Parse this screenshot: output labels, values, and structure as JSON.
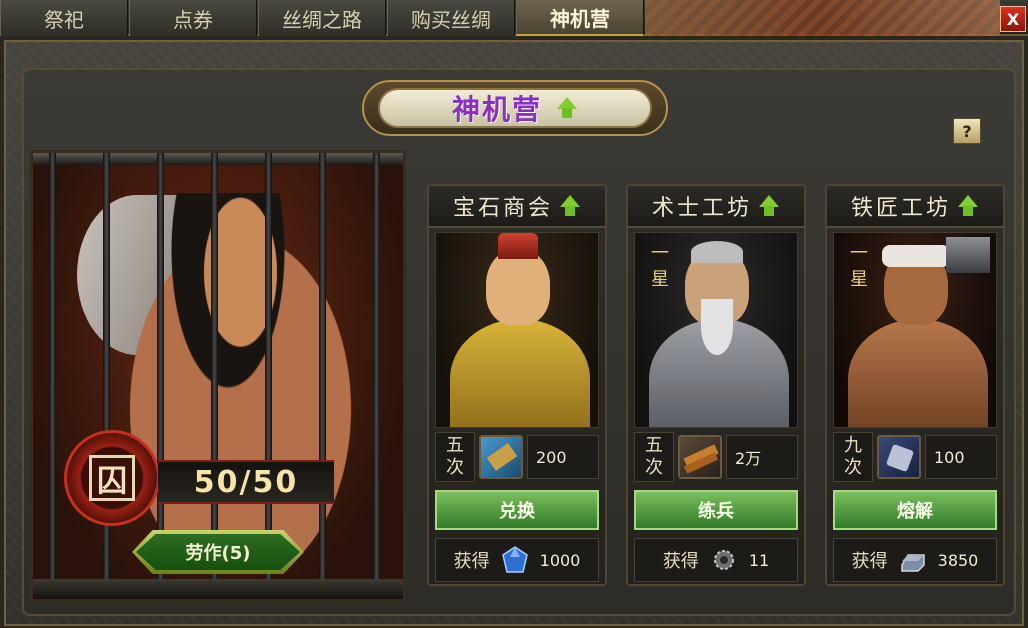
{
  "tabs": [
    {
      "label": "祭祀"
    },
    {
      "label": "点券"
    },
    {
      "label": "丝绸之路"
    },
    {
      "label": "购买丝绸"
    },
    {
      "label": "神机营",
      "active": true
    }
  ],
  "close_label": "X",
  "header": {
    "title": "神机营",
    "help_label": "?"
  },
  "prison": {
    "seal_char": "囚",
    "capacity": "50/50",
    "labor_button": "劳作(5)"
  },
  "shops": [
    {
      "name": "宝石商会",
      "star": "",
      "times_line1": "五",
      "times_line2": "次",
      "cost_icon": "scroll-icon",
      "cost_value": "200",
      "action_label": "兑换",
      "gain_label": "获得",
      "gain_icon": "blue-gem-icon",
      "gain_value": "1000"
    },
    {
      "name": "术士工坊",
      "star": "一星",
      "times_line1": "五",
      "times_line2": "次",
      "cost_icon": "wood-bundle-icon",
      "cost_value": "2万",
      "action_label": "练兵",
      "gain_label": "获得",
      "gain_icon": "gear-ore-icon",
      "gain_value": "11"
    },
    {
      "name": "铁匠工坊",
      "star": "一星",
      "times_line1": "九",
      "times_line2": "次",
      "cost_icon": "iron-ore-icon",
      "cost_value": "100",
      "action_label": "熔解",
      "gain_label": "获得",
      "gain_icon": "iron-ingot-icon",
      "gain_value": "3850"
    }
  ],
  "colors": {
    "title_purple": "#8a2fc1",
    "action_green": "#2f7a2a",
    "seal_red": "#9b2015",
    "upgrade_arrow": "#7fcf2f"
  }
}
